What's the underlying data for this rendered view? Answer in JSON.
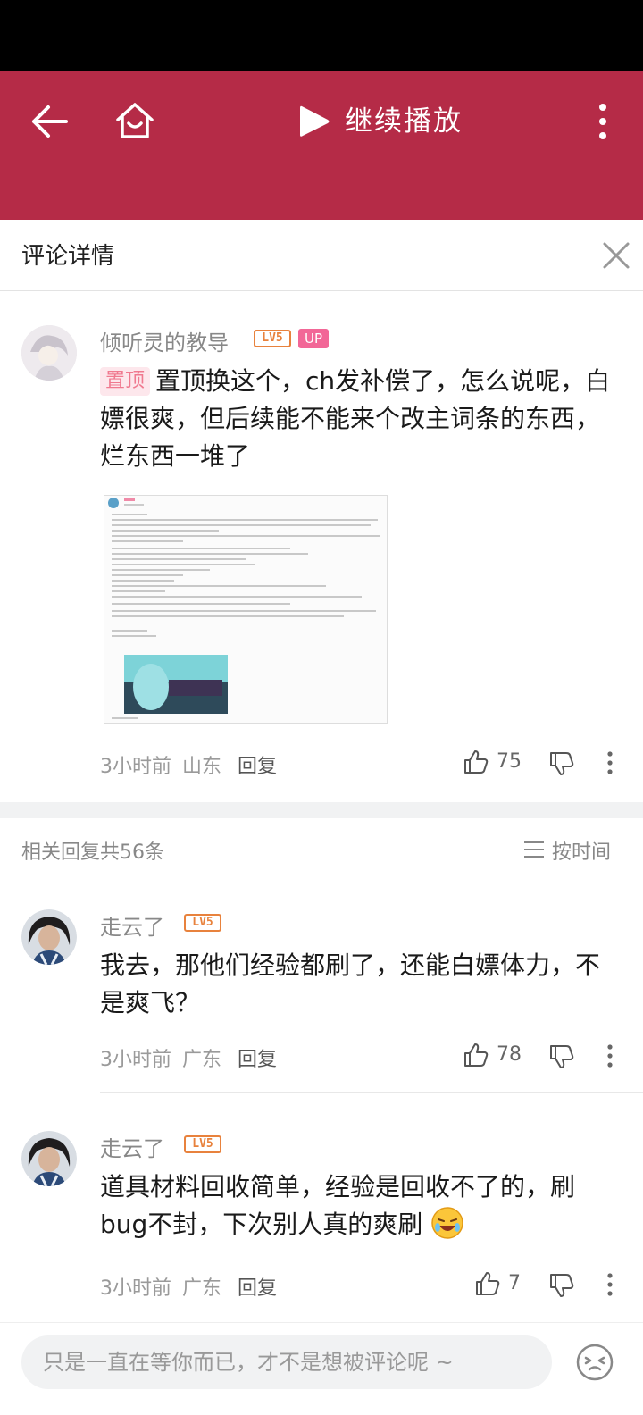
{
  "topbar": {
    "continue_label": "继续播放"
  },
  "panel": {
    "title": "评论详情"
  },
  "main_comment": {
    "user": "倾听灵的教导",
    "level": "LV5",
    "up_badge": "UP",
    "pin_label": "置顶",
    "text": "置顶换这个，ch发补偿了，怎么说呢，白嫖很爽，但后续能不能来个改主词条的东西，烂东西一堆了",
    "time": "3小时前",
    "location": "山东",
    "reply_label": "回复",
    "likes": "75"
  },
  "replies_header": {
    "count_label": "相关回复共56条",
    "sort_label": "按时间"
  },
  "replies": [
    {
      "user": "走云了",
      "level": "LV5",
      "text": "我去，那他们经验都刷了，还能白嫖体力，不是爽飞？",
      "time": "3小时前",
      "location": "广东",
      "reply_label": "回复",
      "likes": "78"
    },
    {
      "user": "走云了",
      "level": "LV5",
      "text": "道具材料回收简单，经验是回收不了的，刷bug不封，下次别人真的爽刷",
      "time": "3小时前",
      "location": "广东",
      "reply_label": "回复",
      "likes": "7"
    }
  ],
  "bottom": {
    "input_placeholder": "只是一直在等你而已，才不是想被评论呢 ~"
  },
  "colors": {
    "brand": "#b52b47",
    "level": "#e8823d",
    "up": "#f26797"
  },
  "icons": [
    "back-icon",
    "home-icon",
    "play-icon",
    "more-icon",
    "close-icon",
    "like-icon",
    "dislike-icon",
    "emoji-icon",
    "sort-icon"
  ]
}
